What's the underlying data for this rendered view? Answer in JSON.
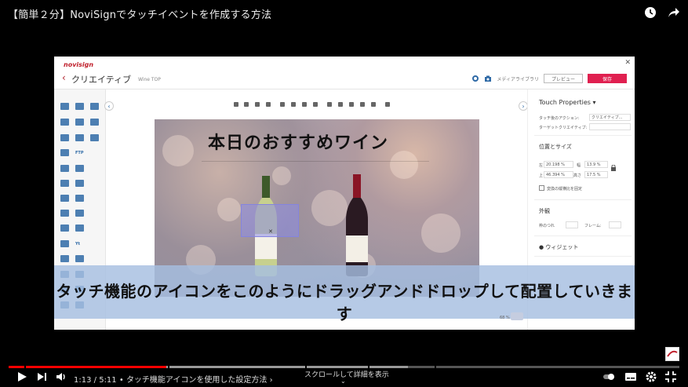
{
  "video": {
    "title": "【簡単２分】NoviSignでタッチイベントを作成する方法",
    "time_current": "1:13",
    "time_total": "5:11",
    "chapter": "タッチ機能アイコンを使用した設定方法",
    "scroll_hint": "スクロールして詳細を表示",
    "progress_played_fraction": 0.235,
    "progress_loaded_fraction": 0.595,
    "subtitle": "タッチ機能のアイコンをこのようにドラッグアンドドロップして配置していきます",
    "accent_color": "#ff0000"
  },
  "app": {
    "logo": "novisign",
    "back_label": "‹",
    "page_title": "クリエイティブ",
    "breadcrumb": "Wine TOP",
    "media_label": "メディアライブラリ",
    "preview_label": "プレビュー",
    "save_label": "保存",
    "brand_color": "#e02050",
    "tool_labels": {
      "ftp": "FTP",
      "yt": "Yt"
    },
    "canvas": {
      "title": "本日のおすすめワイン",
      "zoom": "68 %"
    },
    "panel": {
      "touch_properties": "Touch Properties",
      "touch_action_label": "タッチ後のアクション:",
      "touch_action_value": "クリエイティブ...",
      "target_label": "ターゲットクリエイティブ:",
      "position_size": "位置とサイズ",
      "x_label": "左",
      "x_value": "20.198",
      "w_label": "幅",
      "w_value": "13.9",
      "y_label": "上",
      "y_value": "46.394",
      "h_label": "高さ",
      "h_value": "17.5",
      "unit": "%",
      "keep_ratio": "変換の縦横比を固定",
      "appearance": "外観",
      "border_radius": "枠のつれ",
      "frame": "フレーム:",
      "widget": "ウィジェット"
    }
  }
}
